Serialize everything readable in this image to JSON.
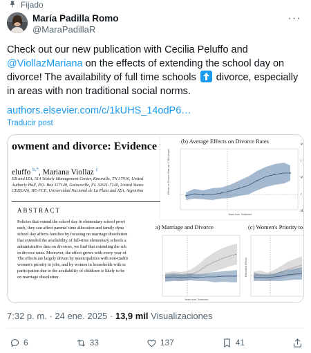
{
  "pinned_label": "Fijado",
  "author": {
    "name": "María Padilla Romo",
    "handle": "@MaraPadillaR"
  },
  "tweet": {
    "text_before_mention": "Check out our new publication with Cecilia Peluffo and ",
    "mention": "@ViollazMariana",
    "text_after_mention": " on the effects of extending the school day on divorce! The availability of full time schools ",
    "text_after_emoji": " divorce, especially in areas with non traditional social norms.",
    "emoji_icon": "up-arrow-emoji-icon",
    "link": "authors.elsevier.com/c/1kUHS_14odP6…",
    "translate": "Traducir post"
  },
  "media": {
    "paper_title": "owment and divorce: Evidence from",
    "authors_a": "eluffo ",
    "authors_sup": "b,*",
    "authors_b": ", Mariana Viollaz ",
    "authors_sup2": "c",
    "affiliations": "ER and IZA, 514 Stokely Management Center, Knoxville, TN 37916, United\nAuthorly Hall, P.O. Box 117140, Gainesville, FL 32611-7140, United States\nCEDLAS), IIE-FCE, Universidad Nacional de La Plata and IZA, Argentina",
    "abstract_heading": "ABSTRACT",
    "abstract_body": "Policies that extend the school day in elementary school provi\nsuch, they can affect parents' time allocation and family dyna\nschool day affects families by focusing on marriage dissolution\nthat extended the availability of full-time elementary schools a\nadministrative data on divorces, we find that extending the sch\nin divorce rates. Moreover, the effect grows with every year of\nThe effects are largely driven by municipalities with non-traditi\nwomen's priority to jobs, and by women in households with sc\nparticipation due to the availability of childcare is likely to be\non marriage dissolution.",
    "fig_b_title": "(b)  Average Effects on Divorce Rates",
    "fig_b_ylabel": "Effects on Divorce Rate per 1,000 people",
    "fig_b_xlabel": "Years from Treatment",
    "fig_c_title": "a)  Marriage and Divorce",
    "fig_c_xlabel": "Years from Treatment",
    "fig_d_title": "(c)  Women's Priority to",
    "fig_d_ylabel": "Estimated Effects",
    "side_letters": "P\n\nl\n\nP\n\nr\n\nR"
  },
  "meta": {
    "time": "7:32 p. m.",
    "date": "24 ene. 2025",
    "views_count": "13,9 mil",
    "views_label": "Visualizaciones"
  },
  "actions": {
    "replies": "6",
    "reposts": "33",
    "likes": "137",
    "bookmarks": "41"
  },
  "colors": {
    "accent": "#1d9bf0",
    "text": "#0f1419",
    "muted": "#536471",
    "band_blue": "#5a7fa8"
  }
}
